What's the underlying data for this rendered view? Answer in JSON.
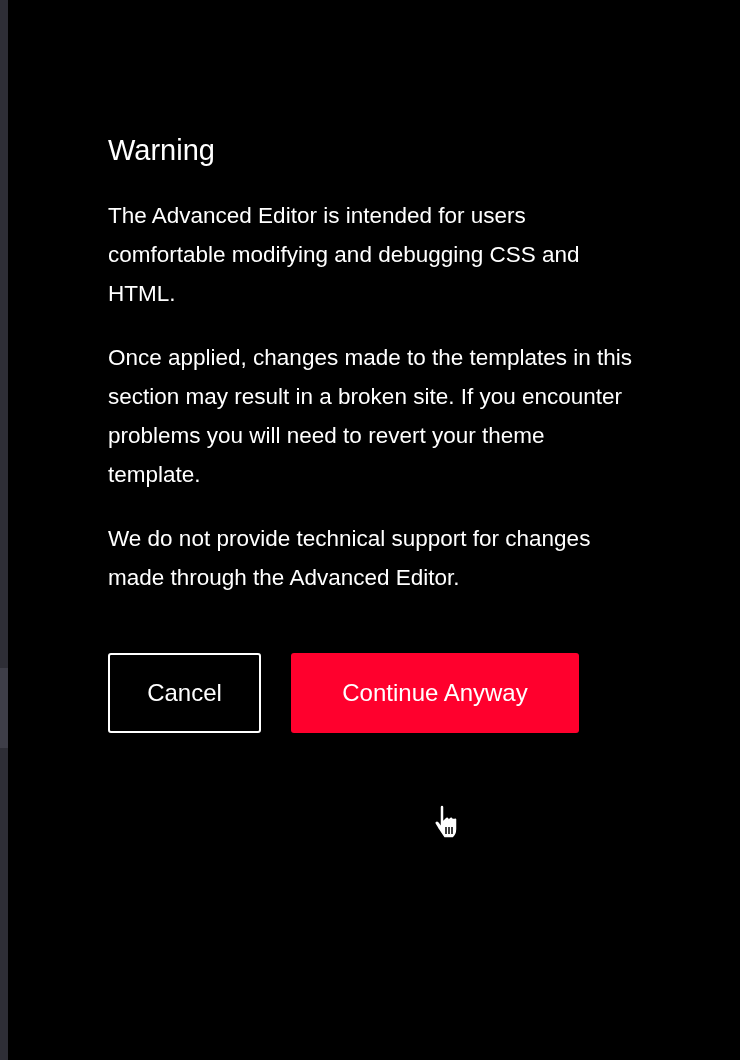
{
  "dialog": {
    "title": "Warning",
    "paragraphs": [
      "The Advanced Editor is intended for users comfortable modifying and debugging CSS and HTML.",
      "Once applied, changes made to the templates in this section may result in a broken site. If you encounter problems you will need to revert your theme template.",
      "We do not provide technical support for changes made through the Advanced Editor."
    ],
    "buttons": [
      {
        "label": "Cancel",
        "kind": "secondary"
      },
      {
        "label": "Continue Anyway",
        "kind": "primary"
      }
    ]
  }
}
